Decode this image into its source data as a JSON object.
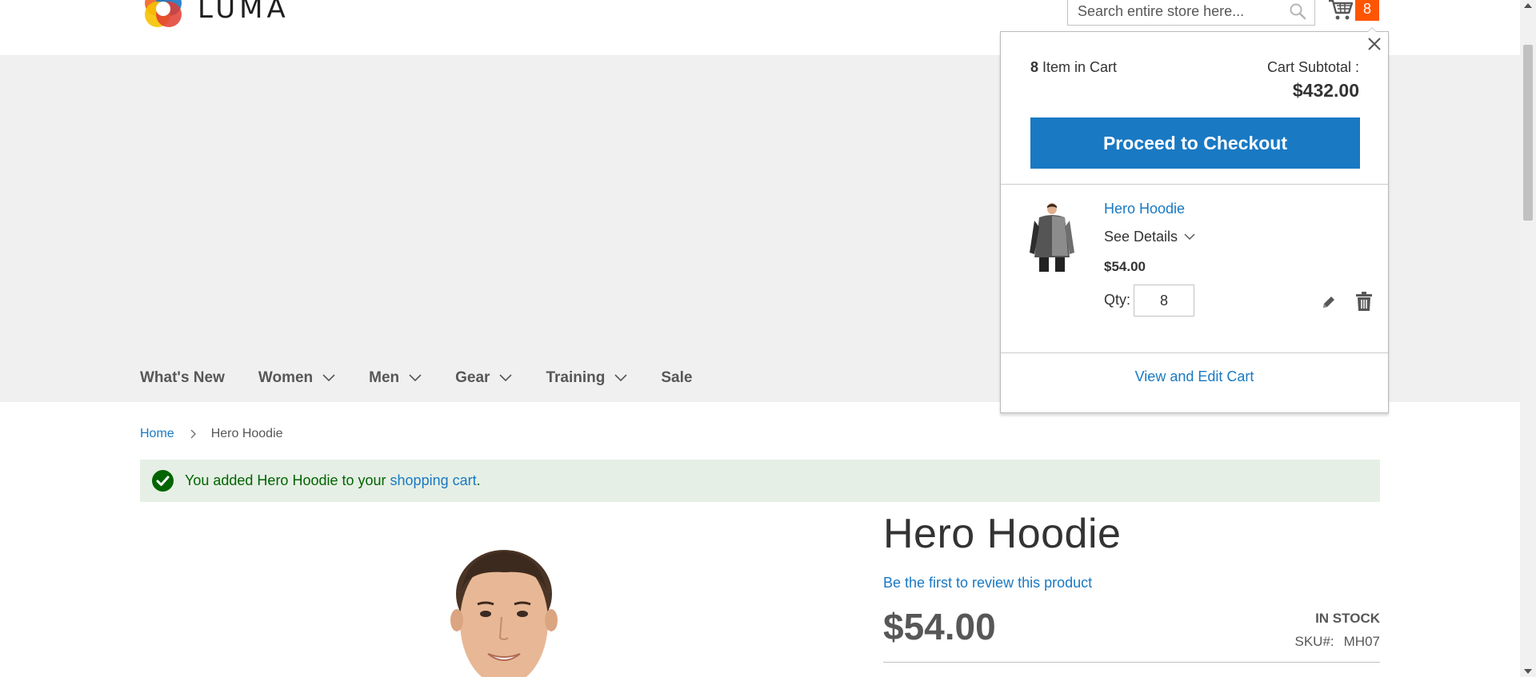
{
  "header": {
    "logo_text": "LUMA",
    "search_placeholder": "Search entire store here...",
    "cart_count": "8"
  },
  "nav": {
    "items": [
      {
        "label": "What's New",
        "has_dropdown": false
      },
      {
        "label": "Women",
        "has_dropdown": true
      },
      {
        "label": "Men",
        "has_dropdown": true
      },
      {
        "label": "Gear",
        "has_dropdown": true
      },
      {
        "label": "Training",
        "has_dropdown": true
      },
      {
        "label": "Sale",
        "has_dropdown": false
      }
    ]
  },
  "breadcrumb": {
    "home": "Home",
    "current": "Hero Hoodie"
  },
  "message": {
    "prefix": "You added Hero Hoodie to your ",
    "link": "shopping cart",
    "suffix": "."
  },
  "product": {
    "title": "Hero Hoodie",
    "review_link": "Be the first to review this product",
    "price": "$54.00",
    "stock": "IN STOCK",
    "sku_label": "SKU#:",
    "sku_value": "MH07"
  },
  "minicart": {
    "item_count": "8",
    "item_count_label": " Item in Cart",
    "subtotal_label": "Cart Subtotal :",
    "subtotal": "$432.00",
    "checkout_label": "Proceed to Checkout",
    "item": {
      "name": "Hero Hoodie",
      "see_details": "See Details",
      "price": "$54.00",
      "qty_label": "Qty:",
      "qty": "8"
    },
    "view_cart_label": "View and Edit Cart"
  },
  "colors": {
    "accent_blue": "#1979c3",
    "cart_badge": "#ff5501",
    "success_bg": "#e5efe5",
    "success_text": "#006400",
    "band_gray": "#f0f0f0"
  }
}
